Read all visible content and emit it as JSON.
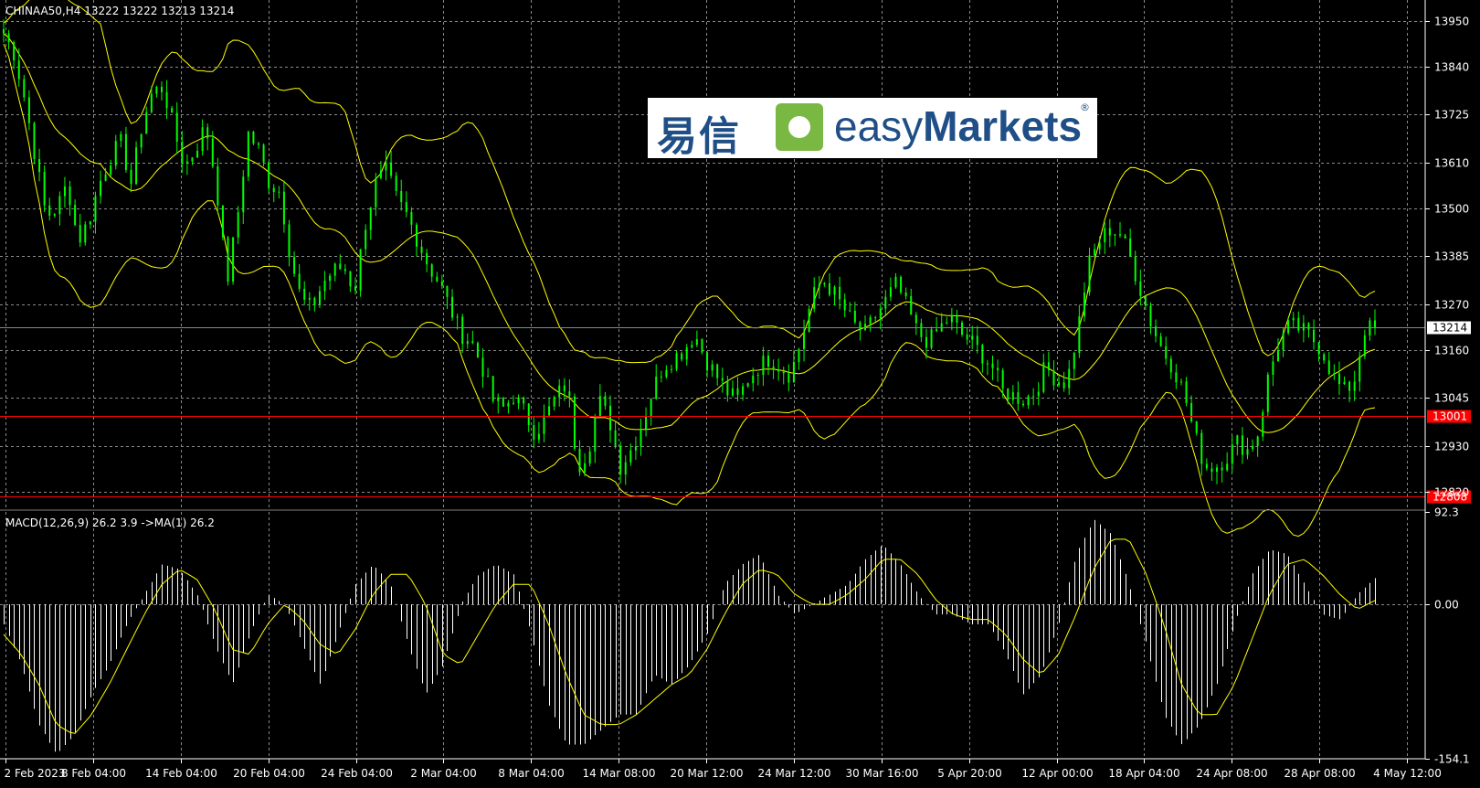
{
  "window": {
    "symbol_header": "CHINAA50,H4  13222 13222 13213 13214",
    "indicator_header": "MACD(12,26,9) 26.2 3.9  ->MA(1) 26.2"
  },
  "watermark": {
    "cn": "易信",
    "brand_prefix": "easy",
    "brand_suffix": "Markets",
    "reg": "®"
  },
  "colors": {
    "background": "#000000",
    "grid": "#8a8a8a",
    "candles": "#00ff00",
    "bands": "#ffff00",
    "support": "#ff0000",
    "price_line": "#7a8aa0",
    "histogram": "#ffffff",
    "signal": "#ffff00"
  },
  "chart_data": [
    {
      "type": "candlestick",
      "title": "CHINAA50,H4",
      "ohlc_last": {
        "open": 13222,
        "high": 13222,
        "low": 13213,
        "close": 13214
      },
      "y_ticks": [
        13950,
        13840,
        13725,
        13610,
        13500,
        13385,
        13270,
        13160,
        13045,
        12930,
        12820
      ],
      "ylim": [
        12780,
        14000
      ],
      "x_ticks": [
        "2 Feb 2023",
        "8 Feb 04:00",
        "14 Feb 04:00",
        "20 Feb 04:00",
        "24 Feb 04:00",
        "2 Mar 04:00",
        "8 Mar 04:00",
        "14 Mar 08:00",
        "20 Mar 12:00",
        "24 Mar 12:00",
        "30 Mar 16:00",
        "5 Apr 20:00",
        "12 Apr 00:00",
        "18 Apr 04:00",
        "24 Apr 08:00",
        "28 Apr 08:00",
        "4 May 12:00"
      ],
      "close_path": [
        13920,
        13870,
        13760,
        13620,
        13480,
        13500,
        13560,
        13420,
        13470,
        13560,
        13620,
        13660,
        13560,
        13700,
        13780,
        13790,
        13690,
        13600,
        13640,
        13700,
        13560,
        13320,
        13480,
        13680,
        13640,
        13560,
        13540,
        13380,
        13280,
        13260,
        13320,
        13350,
        13360,
        13300,
        13460,
        13560,
        13590,
        13520,
        13480,
        13420,
        13360,
        13320,
        13260,
        13200,
        13180,
        13120,
        13040,
        13020,
        13050,
        13010,
        12960,
        13000,
        13050,
        13080,
        12880,
        12920,
        13040,
        12990,
        12880,
        12920,
        12980,
        13060,
        13120,
        13140,
        13160,
        13200,
        13140,
        13100,
        13060,
        13040,
        13090,
        13120,
        13140,
        13120,
        13100,
        13180,
        13280,
        13330,
        13300,
        13260,
        13220,
        13200,
        13240,
        13280,
        13320,
        13260,
        13200,
        13180,
        13210,
        13240,
        13200,
        13180,
        13150,
        13120,
        13060,
        13050,
        13040,
        13060,
        13120,
        13090,
        13080,
        13200,
        13360,
        13420,
        13450,
        13440,
        13380,
        13300,
        13220,
        13160,
        13120,
        13060,
        12960,
        12880,
        12880,
        12900,
        12940,
        12920,
        12960,
        13100,
        13180,
        13220,
        13210,
        13190,
        13160,
        13100,
        13060,
        13080,
        13210,
        13214
      ],
      "support_levels": [
        {
          "label": "13001",
          "value": 13001
        },
        {
          "label": "12808",
          "value": 12808
        }
      ],
      "current_price": {
        "label": "13214",
        "value": 13214
      },
      "bands": {
        "type": "Bollinger",
        "color": "yellow"
      }
    },
    {
      "type": "histogram",
      "title": "MACD(12,26,9)",
      "macd": 26.2,
      "signal": 3.9,
      "ma": 26.2,
      "y_ticks": [
        "92.3",
        "0.00",
        "-154.1"
      ],
      "ylim": [
        -154.1,
        92.3
      ],
      "macd_path": [
        -20,
        -60,
        -120,
        -150,
        -130,
        -90,
        -60,
        -20,
        10,
        40,
        35,
        10,
        -40,
        -80,
        -30,
        10,
        0,
        -40,
        -80,
        -30,
        20,
        40,
        20,
        -40,
        -90,
        -60,
        0,
        30,
        40,
        30,
        -30,
        -100,
        -140,
        -140,
        -125,
        -110,
        -110,
        -70,
        -80,
        -60,
        -30,
        20,
        40,
        50,
        10,
        -10,
        0,
        10,
        20,
        45,
        60,
        40,
        10,
        -10,
        -10,
        -20,
        -20,
        -50,
        -90,
        -70,
        -20,
        50,
        85,
        70,
        20,
        -40,
        -110,
        -140,
        -120,
        -80,
        -20,
        30,
        55,
        50,
        20,
        -10,
        -15,
        10,
        26.2
      ],
      "signal_path": [
        -30,
        -50,
        -80,
        -120,
        -130,
        -110,
        -80,
        -45,
        -10,
        20,
        35,
        25,
        -5,
        -45,
        -50,
        -20,
        0,
        -15,
        -40,
        -50,
        -25,
        10,
        30,
        30,
        0,
        -50,
        -60,
        -30,
        0,
        20,
        20,
        -20,
        -70,
        -110,
        -120,
        -120,
        -110,
        -95,
        -80,
        -70,
        -45,
        -10,
        20,
        35,
        30,
        10,
        0,
        0,
        10,
        25,
        45,
        45,
        30,
        5,
        -10,
        -15,
        -15,
        -30,
        -55,
        -70,
        -50,
        -10,
        35,
        65,
        65,
        30,
        -20,
        -80,
        -110,
        -110,
        -80,
        -35,
        10,
        40,
        45,
        30,
        10,
        -5,
        3.9
      ]
    }
  ]
}
